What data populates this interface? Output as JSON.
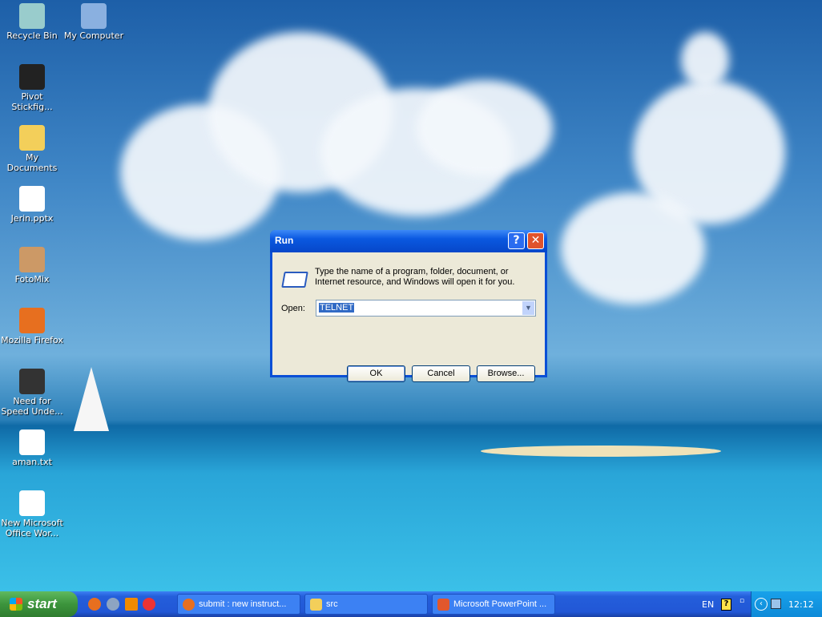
{
  "desktop_icons": [
    {
      "label": "Recycle Bin",
      "icon": "recycle-bin-icon"
    },
    {
      "label": "My Computer",
      "icon": "my-computer-icon"
    },
    {
      "label": "Pivot Stickfig...",
      "icon": "pivot-stickfigure-icon"
    },
    {
      "label": "My Documents",
      "icon": "my-documents-icon"
    },
    {
      "label": "Jerin.pptx",
      "icon": "powerpoint-file-icon"
    },
    {
      "label": "FotoMix",
      "icon": "fotomix-icon"
    },
    {
      "label": "Mozilla Firefox",
      "icon": "firefox-icon"
    },
    {
      "label": "Need for Speed Unde...",
      "icon": "nfs-icon"
    },
    {
      "label": "aman.txt",
      "icon": "text-file-icon"
    },
    {
      "label": "New Microsoft Office Wor...",
      "icon": "word-file-icon"
    }
  ],
  "run_dialog": {
    "title": "Run",
    "help_label": "?",
    "close_label": "✕",
    "description": "Type the name of a program, folder, document, or Internet resource, and Windows will open it for you.",
    "open_label": "Open:",
    "open_value": "TELNET",
    "ok": "OK",
    "cancel": "Cancel",
    "browse": "Browse..."
  },
  "taskbar": {
    "start": "start",
    "quick_launch": [
      "firefox-icon",
      "media-player-icon",
      "vlc-icon",
      "app-icon"
    ],
    "tasks": [
      {
        "label": "submit : new instruct...",
        "icon": "firefox-icon"
      },
      {
        "label": "src",
        "icon": "folder-icon"
      },
      {
        "label": "Microsoft PowerPoint ...",
        "icon": "powerpoint-icon"
      }
    ],
    "language": "EN",
    "clock": "12:12"
  }
}
